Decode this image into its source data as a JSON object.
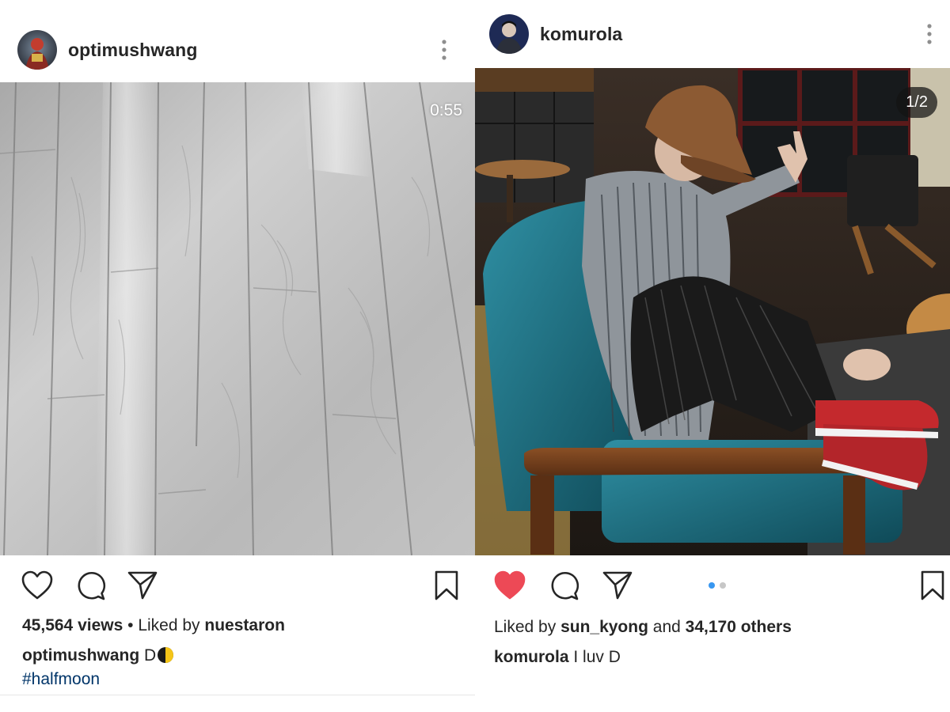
{
  "posts": [
    {
      "username": "optimushwang",
      "avatar_icon": "profile-avatar-dark-figure",
      "media_type": "video",
      "media_description_icon": "wooden-floor-icon",
      "video_time": "0:55",
      "icons": {
        "like": "heart-outline-icon",
        "comment": "comment-icon",
        "share": "send-icon",
        "save": "bookmark-icon",
        "more": "more-vertical-icon"
      },
      "views_count": "45,564 views",
      "views_separator": "•",
      "liked_by_prefix": "Liked by",
      "liked_by_user": "nuestaron",
      "caption_user": "optimushwang",
      "caption_text": "D",
      "caption_emoji": "half-moon-emoji-icon",
      "hashtag": "#halfmoon"
    },
    {
      "username": "komurola",
      "avatar_icon": "profile-avatar-blue-figure",
      "media_type": "carousel",
      "media_description_icon": "person-in-chair-photo-icon",
      "slide_count": "1/2",
      "carousel_dots": 2,
      "active_dot": 0,
      "liked": true,
      "icons": {
        "like": "heart-filled-icon",
        "comment": "comment-icon",
        "share": "send-icon",
        "save": "bookmark-icon",
        "more": "more-vertical-icon"
      },
      "liked_by_prefix": "Liked by",
      "liked_by_user": "sun_kyong",
      "liked_by_and": "and",
      "liked_by_others": "34,170 others",
      "caption_user": "komurola",
      "caption_text": "I luv D"
    }
  ],
  "colors": {
    "like_red": "#ed4956",
    "hashtag_blue": "#003569",
    "dot_active": "#3897f0",
    "text": "#262626"
  }
}
